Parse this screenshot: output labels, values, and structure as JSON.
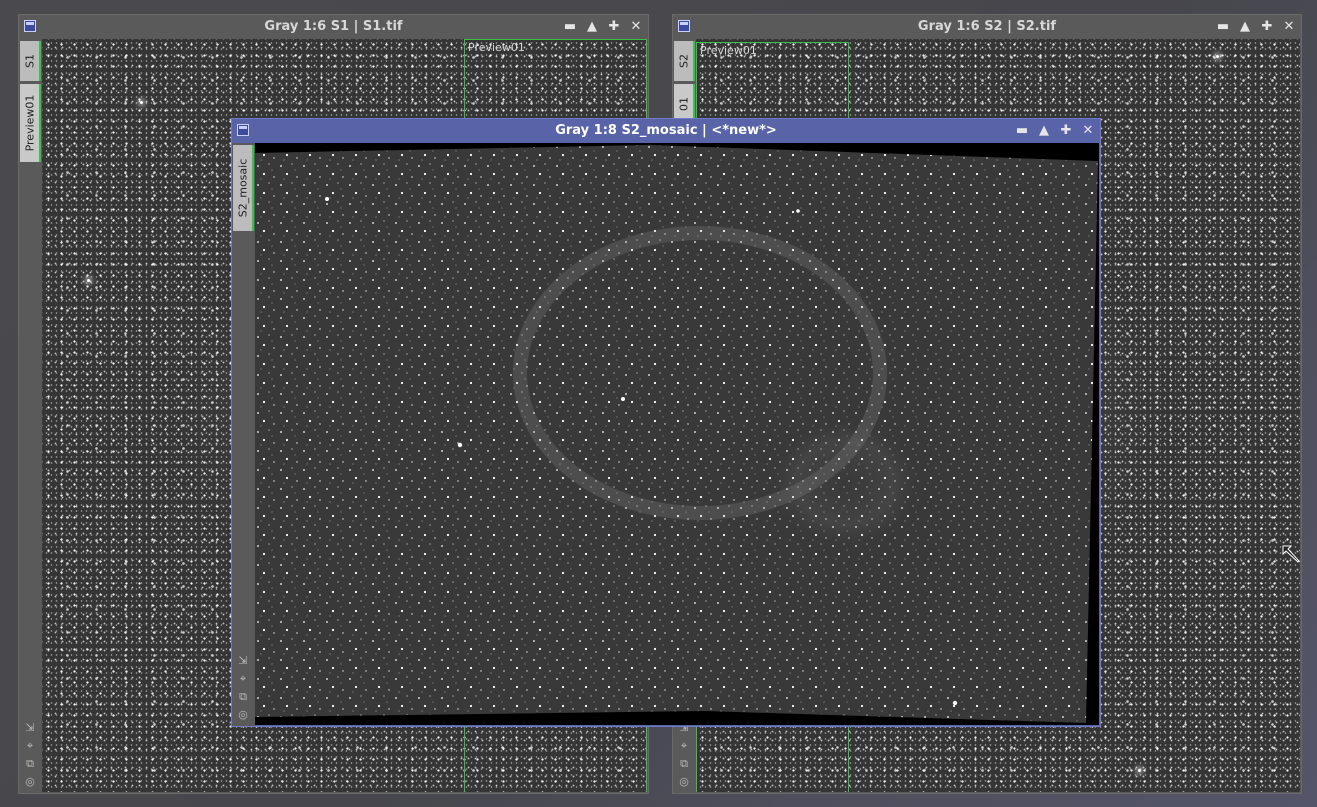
{
  "windows": {
    "s1": {
      "title": "Gray 1:6 S1 | S1.tif",
      "tabs": [
        "S1",
        "Preview01"
      ],
      "preview_label": "Preview01"
    },
    "s2": {
      "title": "Gray 1:6 S2 | S2.tif",
      "tabs": [
        "S2",
        "01"
      ],
      "preview_label": "Preview01"
    },
    "mosaic": {
      "title": "Gray 1:8 S2_mosaic | <*new*>",
      "tabs": [
        "S2_mosaic"
      ]
    }
  },
  "controls": {
    "shade": "▬",
    "maximize": "▲",
    "iconize": "✚",
    "close": "✕"
  },
  "tool_icons": {
    "fit": "⇲",
    "zoom": "⌖",
    "clone": "⧉",
    "track": "◎"
  },
  "colors": {
    "active_frame": "#5964a8",
    "inactive_frame": "#5a5a5a",
    "preview_border": "#3bbf47"
  }
}
